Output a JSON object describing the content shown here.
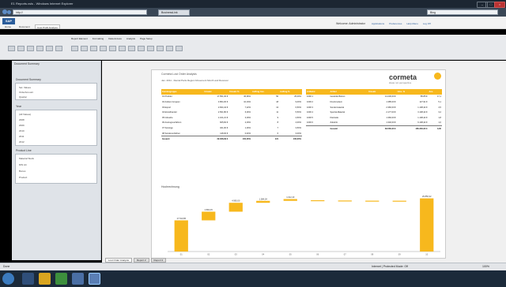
{
  "window": {
    "title": "E1 Reports.xsls - Windows Internet Explorer"
  },
  "browser": {
    "address": "http://",
    "tab": "BusinessLink",
    "search_hint": "Bing"
  },
  "app": {
    "logo": "SAP",
    "user": "Welcome: Administrator",
    "links": [
      "Applications",
      "Preferences",
      "Help Menu",
      "Log Off"
    ],
    "ribbon_tabs": [
      "Home",
      "Document",
      "Cost Profit Analysis"
    ],
    "menus": [
      "Report Element",
      "Formatting",
      "Data Access",
      "Analysis",
      "Page Setup"
    ]
  },
  "side": {
    "header": "Document Summary",
    "sections": [
      {
        "title": "Document Summary",
        "items": [
          "Sel. Values",
          "OrderAmount",
          "Quarter"
        ]
      },
      {
        "title": "Year",
        "items": [
          "(All Values)",
          "2008",
          "2009",
          "2010",
          "2011",
          "2012"
        ]
      },
      {
        "title": "Product Line",
        "items": [
          "Material Stock",
          "DIN A4",
          "Bonus",
          "Product"
        ]
      }
    ]
  },
  "report": {
    "company": "Cormeta Lost Order Analysis",
    "subtitle": "Jan. 2011 - Rental Parts Region Movement Month and Receiver",
    "brand": "cormeta",
    "tagline": "ideas not perspective",
    "left_table": {
      "headers": [
        "Kundengruppe",
        "Umsatz",
        "Umsatz %",
        "Auftrag Anz.",
        "Auftrag %"
      ],
      "rows": [
        [
          "01 Produkt",
          "17.551,30 €",
          "36,96%",
          "50",
          "25,00%"
        ],
        [
          "02 Andere Gruppen",
          "3.864,30 €",
          "10,04%",
          "18",
          "9,00%"
        ],
        [
          "03 Export",
          "2.844,44 €",
          "7,22%",
          "13",
          "6,50%"
        ],
        [
          "04 Einzelhandel",
          "2.561,86 €",
          "6,00%",
          "11",
          "5,50%"
        ],
        [
          "05 Industrie",
          "1.161,21 €",
          "3,03%",
          "9",
          "4,50%"
        ],
        [
          "06 Auszugsverfahren",
          "605,84 €",
          "2,03%",
          "8",
          "4,00%"
        ],
        [
          "07 Sonstige",
          "321,00 €",
          "1,00%",
          "7",
          "3,50%"
        ],
        [
          "08 Sonderverfahren",
          "118,00 €",
          "0,40%",
          "6",
          "3,00%"
        ]
      ],
      "total": [
        "Gesamt",
        "29.028,99 €",
        "100,00%",
        "121",
        "100,00%"
      ]
    },
    "right_table": {
      "headers": [
        "Artikelnr",
        "Artikel",
        "Umsatz",
        "Ums. %",
        "Anz."
      ],
      "rows": [
        [
          "1000 1",
          "Gewinde Bolzen",
          "14.230,00 €",
          "85.85 €",
          "17,1"
        ],
        [
          "1000 2",
          "Druckmuttern",
          "1.385,00 €",
          "127,91 €",
          "5,1"
        ],
        [
          "1000 3",
          "Sondermaterial",
          "2.360,00 €",
          "1.108,42 €",
          "4,5"
        ],
        [
          "1000 4",
          "Spezial-Material",
          "2.177,00 €",
          "3.108,42 €",
          "3,2"
        ],
        [
          "1000 5",
          "Kleinteile",
          "1.360,00 €",
          "1.108,42 €",
          "1,8"
        ],
        [
          "1000 6",
          "Zubehör",
          "1.340,00 €",
          "9.108,42 €",
          "1,0"
        ]
      ],
      "total": [
        "",
        "Gesamt",
        "39.560,00 €",
        "166.230,00 €",
        "0,00"
      ]
    },
    "chart": {
      "title": "Hochrechnung",
      "categories": [
        "01",
        "02",
        "03",
        "04",
        "05",
        "06",
        "07",
        "08",
        "09",
        "10"
      ],
      "labels": [
        "17.510,86",
        "4.863,45",
        "4.995,00",
        "1.084,04",
        "1.012,40",
        "",
        "",
        "",
        "",
        "29.856,32"
      ],
      "sheet_tabs": [
        "Lost Order Analysis",
        "Report 2",
        "Report 3"
      ]
    }
  },
  "chart_data": {
    "type": "bar",
    "title": "Hochrechnung",
    "categories": [
      "01",
      "02",
      "03",
      "04",
      "05",
      "06",
      "07",
      "08",
      "09",
      "10"
    ],
    "values": [
      17510.86,
      4863.45,
      4995.0,
      1084.04,
      1012.4,
      350,
      200,
      100,
      80,
      29856.32
    ],
    "floats": [
      0,
      17510.86,
      22374.31,
      27369.31,
      28453.35,
      28453.35,
      28453.35,
      28453.35,
      28453.35,
      0
    ],
    "ylim": [
      0,
      31000
    ],
    "color": "#f7b81d"
  },
  "status": {
    "text": "Done",
    "zoom": "100%",
    "trusted": "Internet | Protected Mode: Off"
  }
}
